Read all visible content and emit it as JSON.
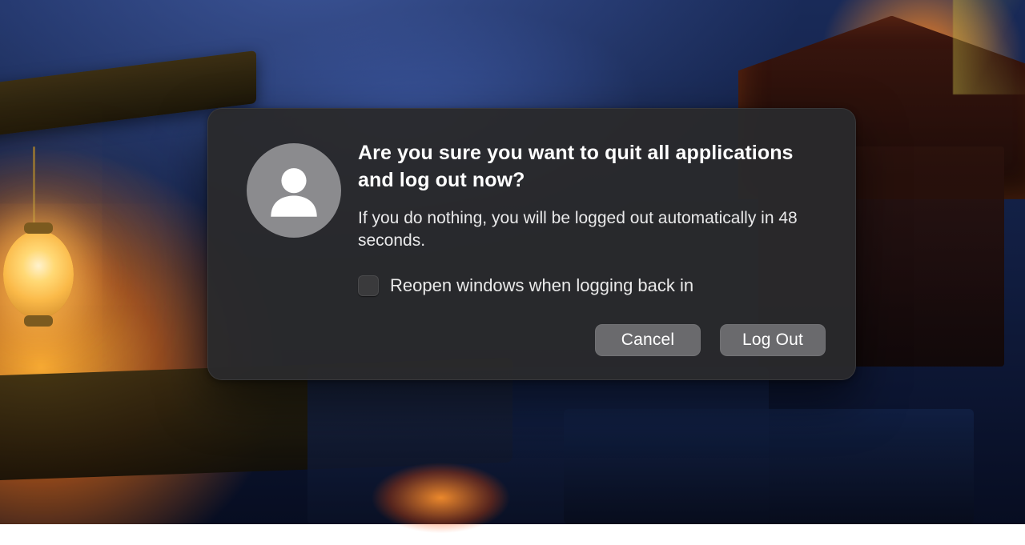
{
  "dialog": {
    "title": "Are you sure you want to quit all applications and log out now?",
    "message": "If you do nothing, you will be logged out automatically in 48 seconds.",
    "checkbox_label": "Reopen windows when logging back in",
    "checkbox_checked": false,
    "buttons": {
      "cancel": "Cancel",
      "confirm": "Log Out"
    },
    "countdown_seconds": 48
  },
  "icons": {
    "avatar": "user-silhouette-icon"
  }
}
